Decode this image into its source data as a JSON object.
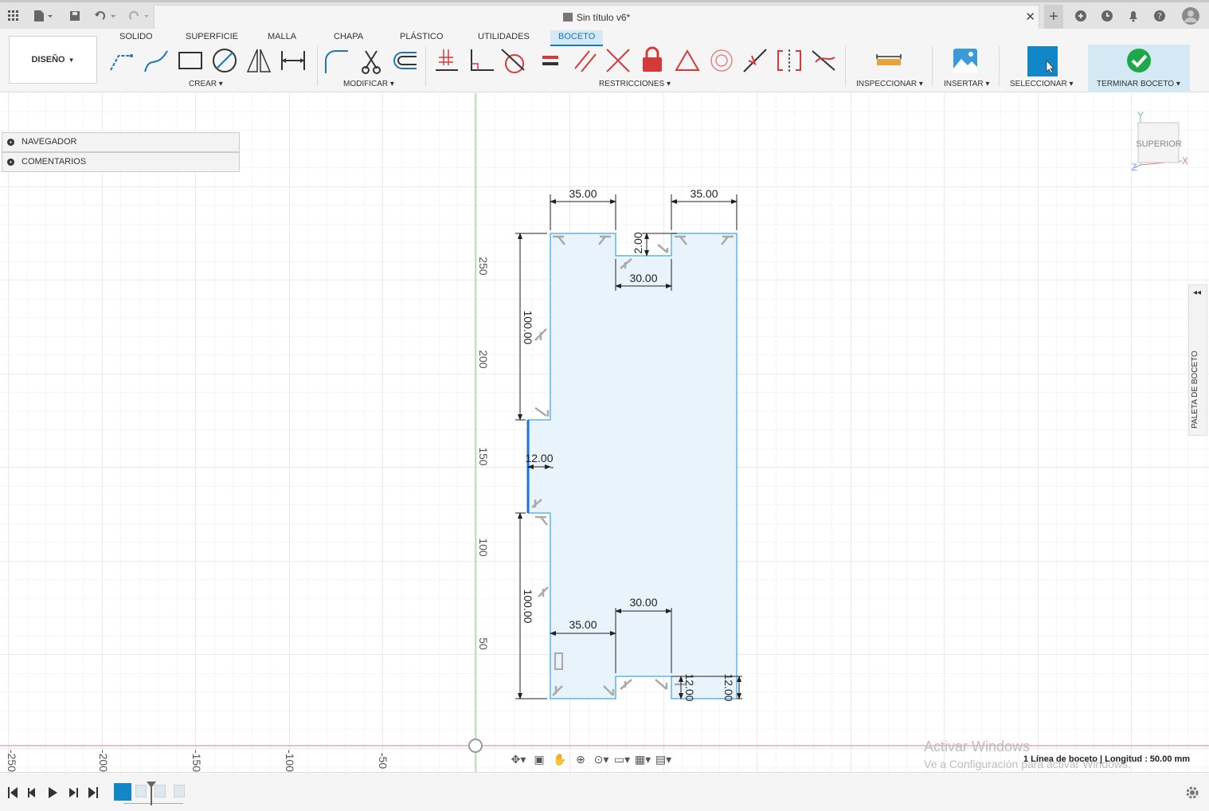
{
  "document": {
    "title": "Sin título v6*"
  },
  "workspace": {
    "label": "DISEÑO"
  },
  "tabs": [
    "SOLIDO",
    "SUPERFICIE",
    "MALLA",
    "CHAPA",
    "PLÁSTICO",
    "UTILIDADES",
    "BOCETO"
  ],
  "active_tab": "BOCETO",
  "groups": {
    "create": "CREAR",
    "modify": "MODIFICAR",
    "constraints": "RESTRICCIONES",
    "inspect": "INSPECCIONAR",
    "insert": "INSERTAR",
    "select": "SELECCIONAR",
    "finish": "TERMINAR BOCETO"
  },
  "browser": {
    "navigator": "NAVEGADOR",
    "comments": "COMENTARIOS"
  },
  "viewcube": {
    "face": "SUPERIOR",
    "axis_x": "X",
    "axis_y": "Y",
    "axis_z": "Z"
  },
  "palette": {
    "label": "PALETA DE BOCETO"
  },
  "dimensions": {
    "top_left_width": "35.00",
    "top_right_width": "35.00",
    "top_notch_depth": "2.00",
    "top_notch_width": "30.00",
    "left_upper_height": "100.00",
    "left_notch_depth": "12.00",
    "left_lower_height": "100.00",
    "bottom_notch_width": "30.00",
    "bottom_left_width": "35.00",
    "bottom_notch_depth": "12.00",
    "bottom_right_depth": "12.00"
  },
  "ruler": {
    "y_ticks": [
      "250",
      "200",
      "150",
      "100",
      "50"
    ],
    "x_ticks": [
      "-250",
      "-200",
      "-150",
      "-100",
      "-50"
    ]
  },
  "status": {
    "selection": "1 Línea de boceto | Longitud : 50.00 mm"
  },
  "watermark": {
    "line1": "Activar Windows",
    "line2": "Ve a Configuración para activar Windows."
  },
  "colors": {
    "accent": "#1978b8",
    "sketch_line": "#5fb6e6",
    "profile_fill": "#e8f3fb",
    "selected_line": "#1a73e8",
    "constraint_lock": "#d33b3b",
    "finish_green": "#1ea84a"
  }
}
